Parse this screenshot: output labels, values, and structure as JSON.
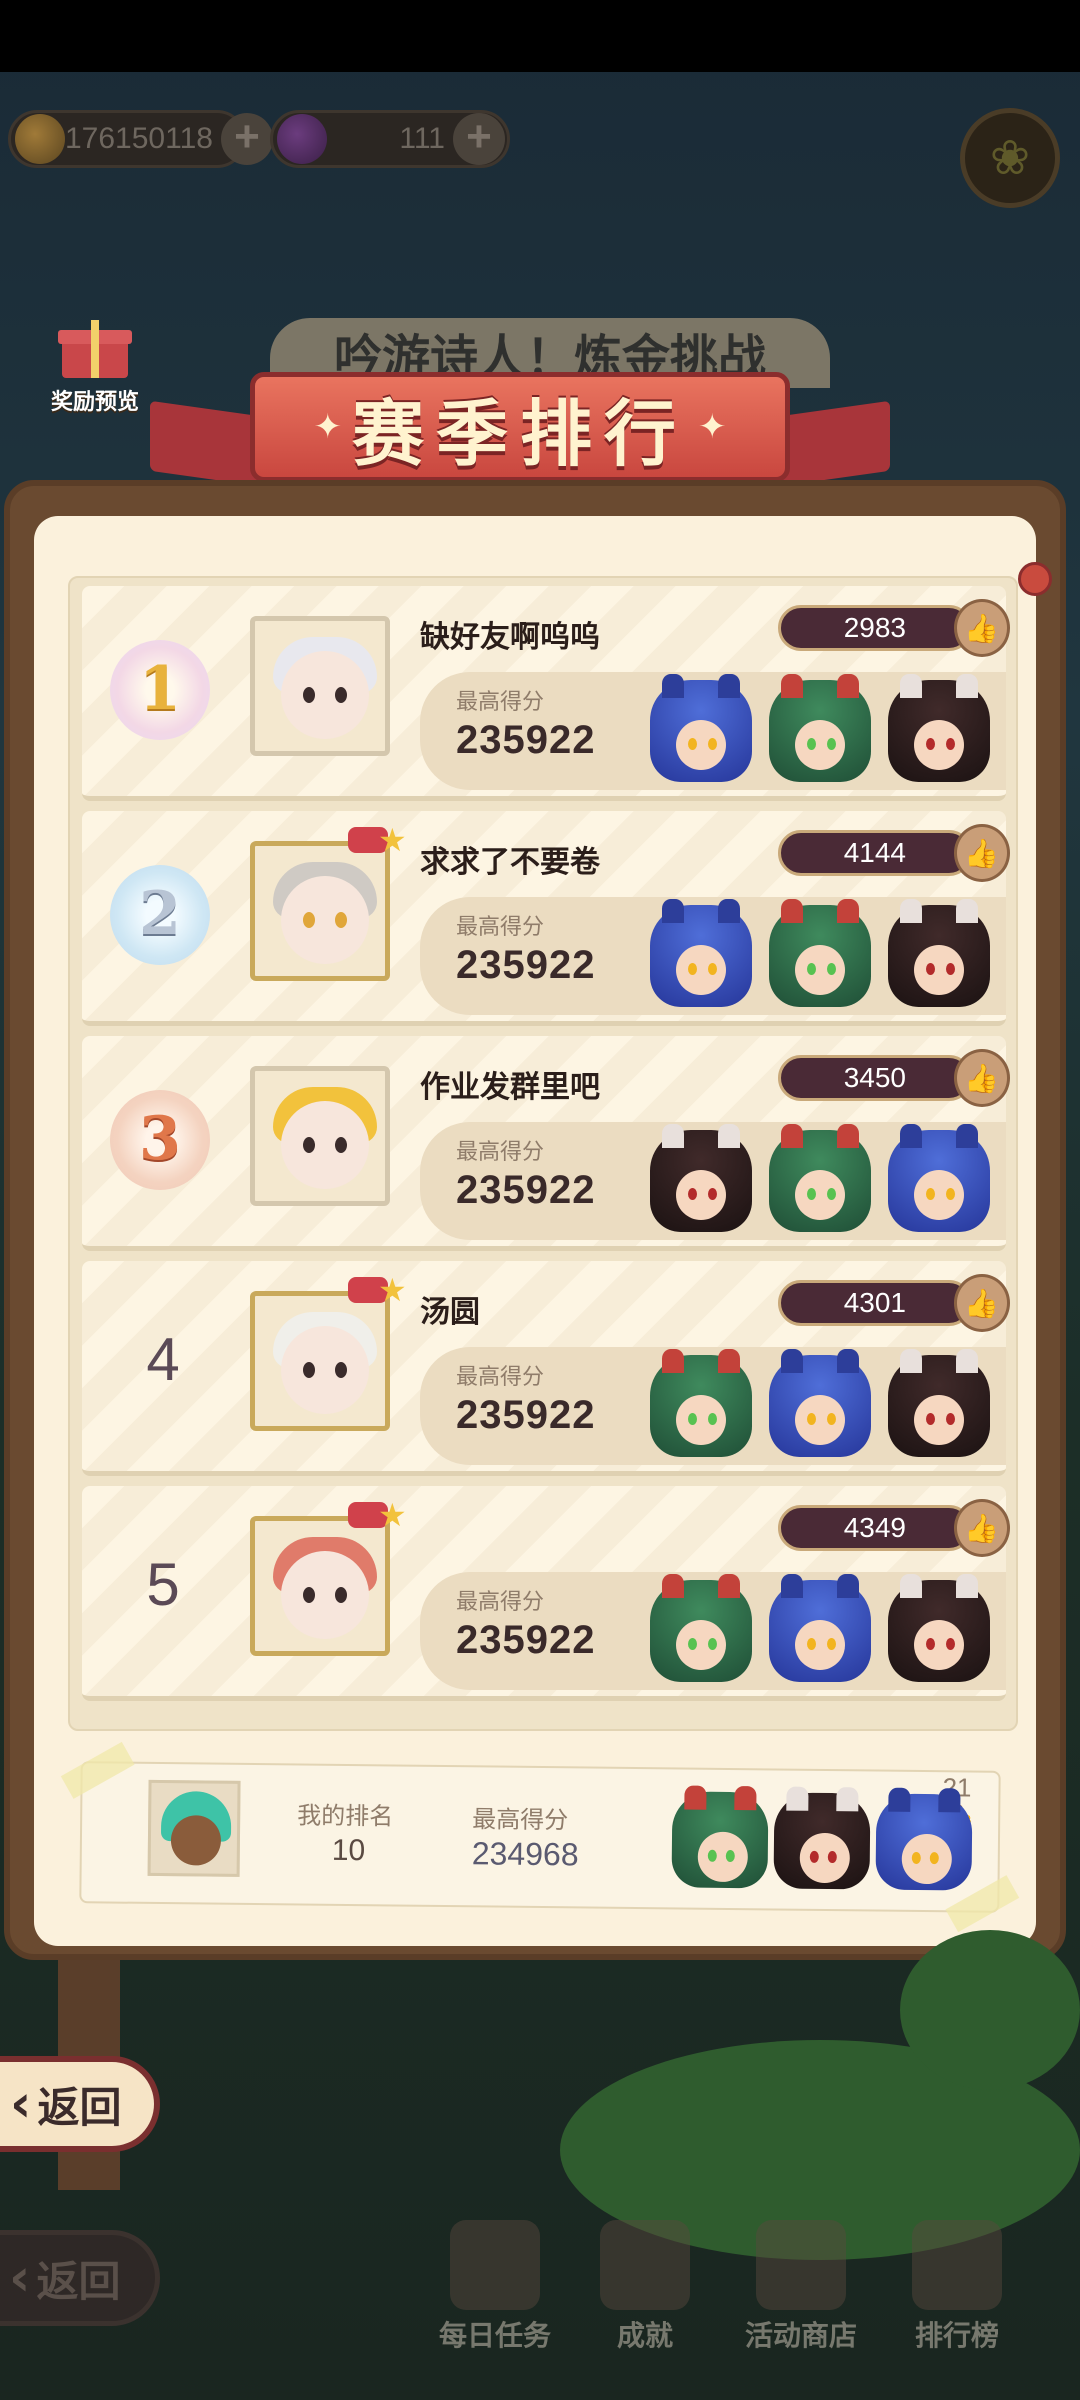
{
  "currency": {
    "coins": "176150118",
    "gems": "111"
  },
  "reward_preview_label": "奖励预览",
  "banner": {
    "background_text": "吟游诗人！炼金挑战",
    "title": "赛季排行"
  },
  "rankings": [
    {
      "rank": "1",
      "name": "缺好友啊呜呜",
      "likes": "2983",
      "score_label": "最高得分",
      "score": "235922",
      "team": [
        "blue",
        "green",
        "dark"
      ]
    },
    {
      "rank": "2",
      "name": "求求了不要卷",
      "likes": "4144",
      "score_label": "最高得分",
      "score": "235922",
      "team": [
        "blue",
        "green",
        "dark"
      ]
    },
    {
      "rank": "3",
      "name": "作业发群里吧",
      "likes": "3450",
      "score_label": "最高得分",
      "score": "235922",
      "team": [
        "dark",
        "green",
        "blue"
      ]
    },
    {
      "rank": "4",
      "name": "汤圆",
      "likes": "4301",
      "score_label": "最高得分",
      "score": "235922",
      "team": [
        "green",
        "blue",
        "dark"
      ]
    },
    {
      "rank": "5",
      "name": "",
      "likes": "4349",
      "score_label": "最高得分",
      "score": "235922",
      "team": [
        "green",
        "blue",
        "dark"
      ]
    }
  ],
  "my_rank": {
    "rank_label": "我的排名",
    "rank": "10",
    "score_label": "最高得分",
    "score": "234968",
    "likes": "21"
  },
  "back_label": "返回",
  "bottom_nav": [
    "每日任务",
    "成就",
    "活动商店",
    "排行榜"
  ],
  "icons": {
    "plus": "+",
    "thumb": "thumbs-up-icon",
    "chevron": "chevron-left-icon"
  }
}
